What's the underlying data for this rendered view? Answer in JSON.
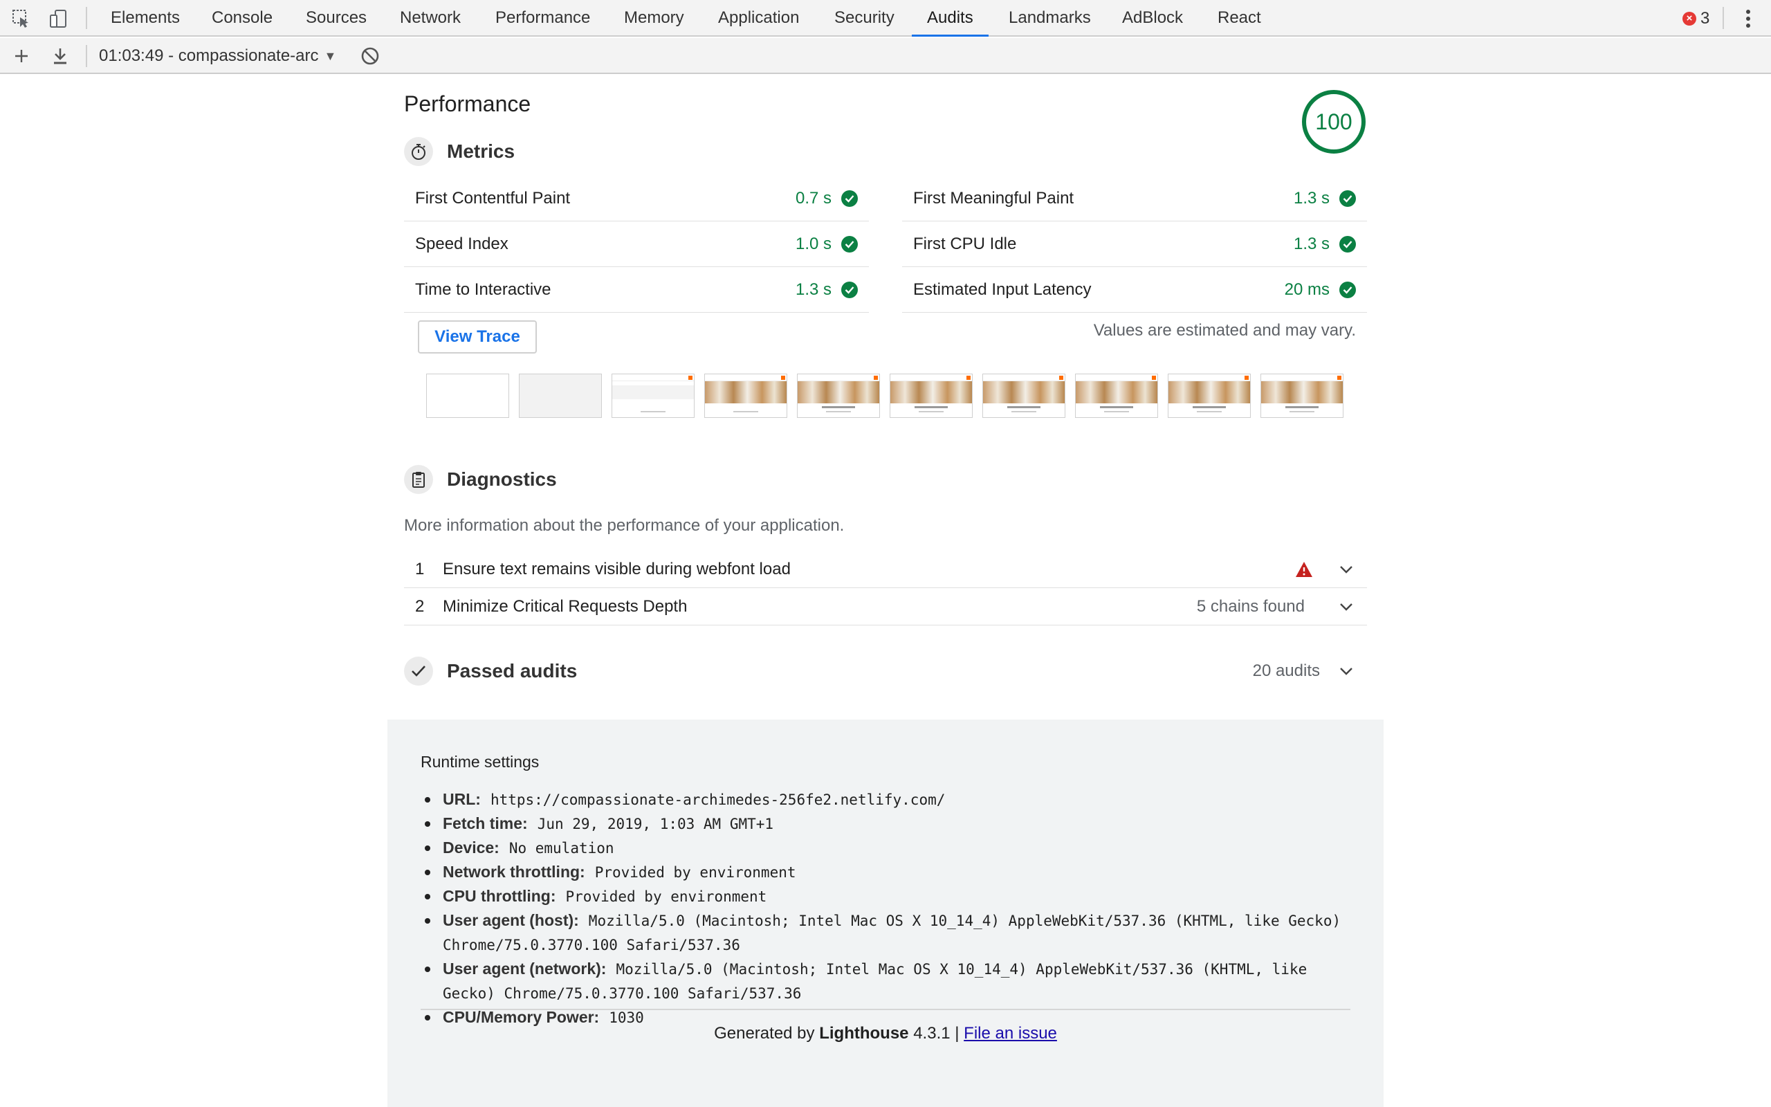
{
  "devtools": {
    "tabs": [
      "Elements",
      "Console",
      "Sources",
      "Network",
      "Performance",
      "Memory",
      "Application",
      "Security",
      "Audits",
      "Landmarks",
      "AdBlock",
      "React"
    ],
    "active_tab": "Audits",
    "error_count": "3",
    "run_label": "01:03:49 - compassionate-arc"
  },
  "report": {
    "category_title": "Performance",
    "score": "100",
    "score_color": "#0b8043",
    "metrics": {
      "title": "Metrics",
      "icon": "stopwatch-icon",
      "left": [
        {
          "name": "First Contentful Paint",
          "value": "0.7 s"
        },
        {
          "name": "Speed Index",
          "value": "1.0 s"
        },
        {
          "name": "Time to Interactive",
          "value": "1.3 s"
        }
      ],
      "right": [
        {
          "name": "First Meaningful Paint",
          "value": "1.3 s"
        },
        {
          "name": "First CPU Idle",
          "value": "1.3 s"
        },
        {
          "name": "Estimated Input Latency",
          "value": "20 ms"
        }
      ],
      "view_trace_label": "View Trace",
      "estimate_note": "Values are estimated and may vary."
    },
    "diagnostics": {
      "title": "Diagnostics",
      "icon": "clipboard-icon",
      "description": "More information about the performance of your application.",
      "items": [
        {
          "num": "1",
          "title": "Ensure text remains visible during webfont load",
          "extra": ""
        },
        {
          "num": "2",
          "title": "Minimize Critical Requests Depth",
          "extra": "5 chains found"
        }
      ]
    },
    "passed": {
      "title": "Passed audits",
      "count": "20 audits"
    },
    "runtime": {
      "title": "Runtime settings",
      "items": [
        {
          "label": "URL:",
          "value": "https://compassionate-archimedes-256fe2.netlify.com/"
        },
        {
          "label": "Fetch time:",
          "value": "Jun 29, 2019, 1:03 AM GMT+1"
        },
        {
          "label": "Device:",
          "value": "No emulation"
        },
        {
          "label": "Network throttling:",
          "value": "Provided by environment"
        },
        {
          "label": "CPU throttling:",
          "value": "Provided by environment"
        },
        {
          "label": "User agent (host):",
          "value": "Mozilla/5.0 (Macintosh; Intel Mac OS X 10_14_4) AppleWebKit/537.36 (KHTML, like Gecko) Chrome/75.0.3770.100 Safari/537.36"
        },
        {
          "label": "User agent (network):",
          "value": "Mozilla/5.0 (Macintosh; Intel Mac OS X 10_14_4) AppleWebKit/537.36 (KHTML, like Gecko) Chrome/75.0.3770.100 Safari/537.36"
        },
        {
          "label": "CPU/Memory Power:",
          "value": "1030"
        }
      ]
    },
    "footer": {
      "generated_prefix": "Generated by",
      "tool_name": "Lighthouse",
      "version": "4.3.1",
      "separator": "|",
      "issue_link": "File an issue"
    }
  },
  "colors": {
    "accent": "#1a73e8",
    "pass": "#0b8043",
    "warn": "#c5221f"
  }
}
